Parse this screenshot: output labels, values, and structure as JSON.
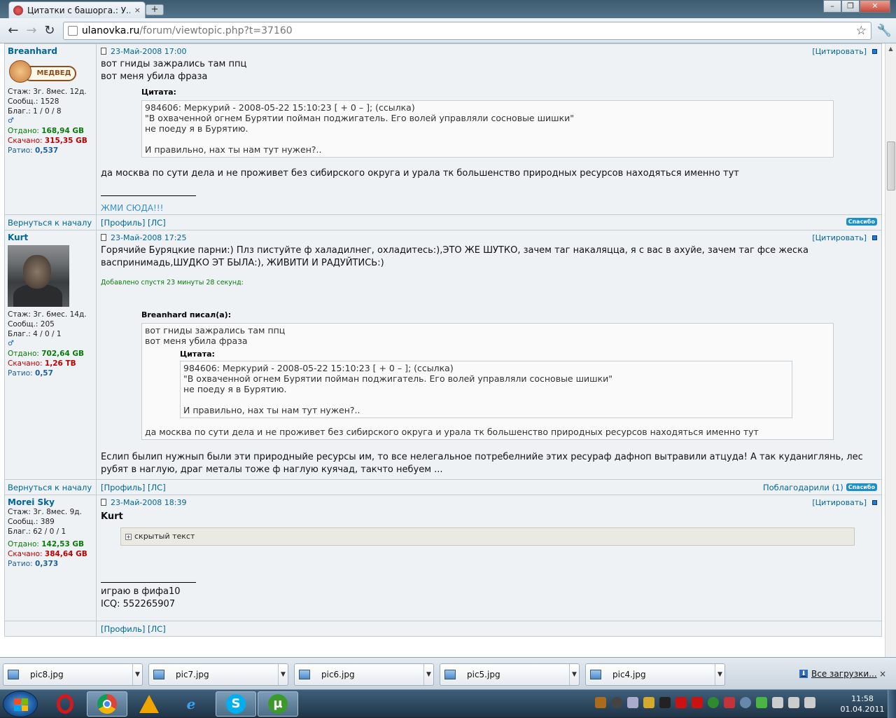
{
  "browser": {
    "tab_title": "Цитатки с башорга.: У...",
    "tab_close": "×",
    "new_tab": "+",
    "url_host": "ulanovka.ru",
    "url_path": "/forum/viewtopic.php?t=37160"
  },
  "posts": [
    {
      "author": "Breanhard",
      "avatar_text": "МЕДВЕД",
      "stazh": "Стаж: 3г. 8мес. 12д.",
      "soobsh": "Сообщ.: 1528",
      "blag": "Благ.: 1 / 0 / 8",
      "gender": "♂",
      "otdano_label": "Отдано:",
      "otdano": "168,94 GB",
      "skachano_label": "Скачано:",
      "skachano": "315,35 GB",
      "ratio_label": "Ратио:",
      "ratio": "0,537",
      "date": "23-Май-2008 17:00",
      "quote_btn": "[Цитировать]",
      "lines": [
        "вот гниды зажрались там ппц",
        "вот меня убила фраза"
      ],
      "quote_label": "Цитата:",
      "quote_lines": [
        "984606: Меркурий - 2008-05-22 15:10:23 [ + 0 – ]; (ссылка)",
        "\"В охваченной огнем Бурятии пойман поджигатель. Его волей управляли сосновые шишки\"",
        "не поеду я в Бурятию.",
        "И правильно, нах ты нам тут нужен?.."
      ],
      "after": "да москва по сути дела и не проживет без сибирского округа и урала тк большенство природных ресурсов находяться именно тут",
      "signature": "ЖМИ СЮДА!!!",
      "back": "Вернуться к началу",
      "profile": "[Профиль]",
      "pm": "[ЛС]",
      "thanks": "Спасибо"
    },
    {
      "author": "Kurt",
      "stazh": "Стаж: 3г. 6мес. 14д.",
      "soobsh": "Сообщ.: 205",
      "blag": "Благ.: 4 / 0 / 1",
      "gender": "♂",
      "otdano_label": "Отдано:",
      "otdano": "702,64 GB",
      "skachano_label": "Скачано:",
      "skachano": "1,26 TB",
      "ratio_label": "Ратио:",
      "ratio": "0,57",
      "date": "23-Май-2008 17:25",
      "quote_btn": "[Цитировать]",
      "text": "Горячийе Буряцкие парни:) Плз пистуйте ф халадилнег, охладитесь:),ЭТО ЖЕ ШУТКО, зачем таг накаляцца, я с вас в ахуйе, зачем таг фсе жеска васпринимадь,ШУДКО ЭТ БЫЛА:), ЖИВИТИ И РАДУЙТИСЬ:)",
      "added": "Добавлено спустя 23 минуты 28 секунд:",
      "quote_author": "Breanhard писал(а):",
      "q_lines": [
        "вот гниды зажрались там ппц",
        "вот меня убила фраза"
      ],
      "inner_label": "Цитата:",
      "inner_lines": [
        "984606: Меркурий - 2008-05-22 15:10:23 [ + 0 – ]; (ссылка)",
        "\"В охваченной огнем Бурятии пойман поджигатель. Его волей управляли сосновые шишки\"",
        "не поеду я в Бурятию.",
        "И правильно, нах ты нам тут нужен?.."
      ],
      "q_after": "да москва по сути дела и не проживет без сибирского округа и урала тк большенство природных ресурсов находяться именно тут",
      "after": "Еслип былип нужнып были эти природныйе ресурсы им, то все нелегальное потребелнийе этих ресураф дафноп вытравили атцуда! А так куданиглянь, лес рубят в наглую, драг металы тоже ф наглую куячад, такчто небуем ...",
      "back": "Вернуться к началу",
      "profile": "[Профиль]",
      "pm": "[ЛС]",
      "thanked": "Поблагодарили (1)",
      "thanks": "Спасибо"
    },
    {
      "author": "Morei Sky",
      "stazh": "Стаж: 3г. 8мес. 9д.",
      "soobsh": "Сообщ.: 389",
      "blag": "Благ.: 62 / 0 / 1",
      "otdano_label": "Отдано:",
      "otdano": "142,53 GB",
      "skachano_label": "Скачано:",
      "skachano": "384,64 GB",
      "ratio_label": "Ратио:",
      "ratio": "0,373",
      "date": "23-Май-2008 18:39",
      "quote_btn": "[Цитировать]",
      "addressee": "Kurt",
      "hidden": "скрытый текст",
      "sig1": "играю в фифа10",
      "sig2": "ICQ: 552265907",
      "profile_pm": "[Профиль] [ЛС]"
    }
  ],
  "downloads": {
    "items": [
      "pic8.jpg",
      "pic7.jpg",
      "pic6.jpg",
      "pic5.jpg",
      "pic4.jpg"
    ],
    "all": "Все загрузки...",
    "close": "×"
  },
  "taskbar": {
    "time": "11:58",
    "date": "01.04.2011"
  }
}
